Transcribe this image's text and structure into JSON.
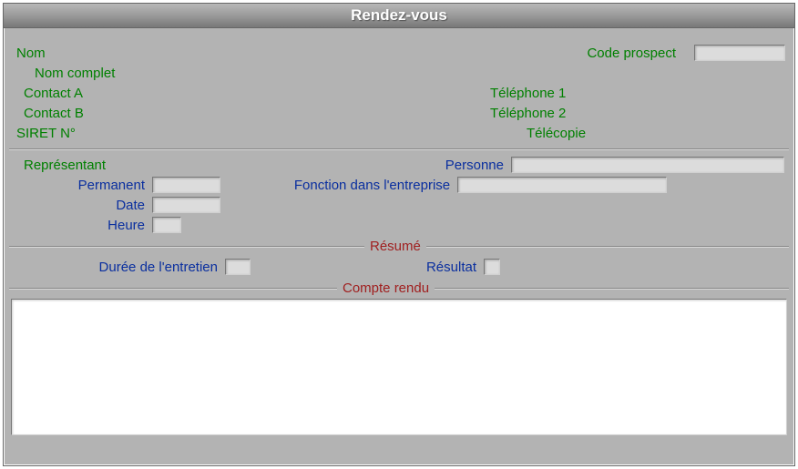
{
  "window": {
    "title": "Rendez-vous"
  },
  "info": {
    "nom": "Nom",
    "nom_complet": "Nom complet",
    "contact_a": "Contact A",
    "contact_b": "Contact B",
    "siret": "SIRET N°",
    "code_prospect": "Code prospect",
    "telephone_1": "Téléphone 1",
    "telephone_2": "Téléphone 2",
    "telecopie": "Télécopie",
    "code_prospect_value": ""
  },
  "details": {
    "representant": "Représentant",
    "permanent": "Permanent",
    "date": "Date",
    "heure": "Heure",
    "personne": "Personne",
    "fonction": "Fonction dans l'entreprise",
    "permanent_value": "",
    "date_value": "",
    "heure_value": "",
    "personne_value": "",
    "fonction_value": ""
  },
  "resume": {
    "legend": "Résumé",
    "duree": "Durée de l'entretien",
    "resultat": "Résultat",
    "duree_value": "",
    "resultat_value": ""
  },
  "compte_rendu": {
    "legend": "Compte rendu",
    "value": ""
  }
}
